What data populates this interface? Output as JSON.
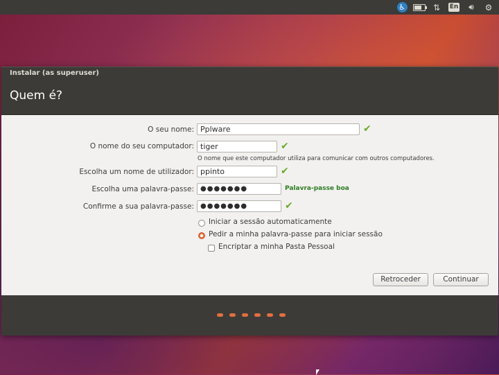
{
  "window": {
    "title": "Instalar (as superuser)",
    "header": "Quem é?"
  },
  "panel": {
    "keyboard_layout": "En",
    "icons": [
      "accessibility-icon",
      "battery-icon",
      "network-icon",
      "keyboard-layout-indicator",
      "volume-icon",
      "settings-gear-icon"
    ]
  },
  "form": {
    "name_label": "O seu nome:",
    "name_value": "Pplware",
    "computer_label": "O nome do seu computador:",
    "computer_value": "tiger",
    "computer_hint": "O nome que este computador utiliza para comunicar com outros computadores.",
    "username_label": "Escolha um nome de utilizador:",
    "username_value": "ppinto",
    "password_label": "Escolha uma palavra-passe:",
    "password_value": "●●●●●●●",
    "password_strength": "Palavra-passe boa",
    "confirm_label": "Confirme a sua palavra-passe:",
    "confirm_value": "●●●●●●●"
  },
  "options": {
    "auto_login": "Iniciar a sessão automaticamente",
    "require_password": "Pedir a minha palavra-passe para iniciar sessão",
    "encrypt_home": "Encriptar a minha Pasta Pessoal",
    "selected": "require_password",
    "encrypt_checked": false
  },
  "buttons": {
    "back": "Retroceder",
    "continue": "Continuar"
  },
  "progress": {
    "steps_total": 6
  },
  "colors": {
    "accent": "#e06a3c",
    "check": "#6aaa2a",
    "strength_good": "#2e7d23",
    "panel": "#3c3b37"
  }
}
